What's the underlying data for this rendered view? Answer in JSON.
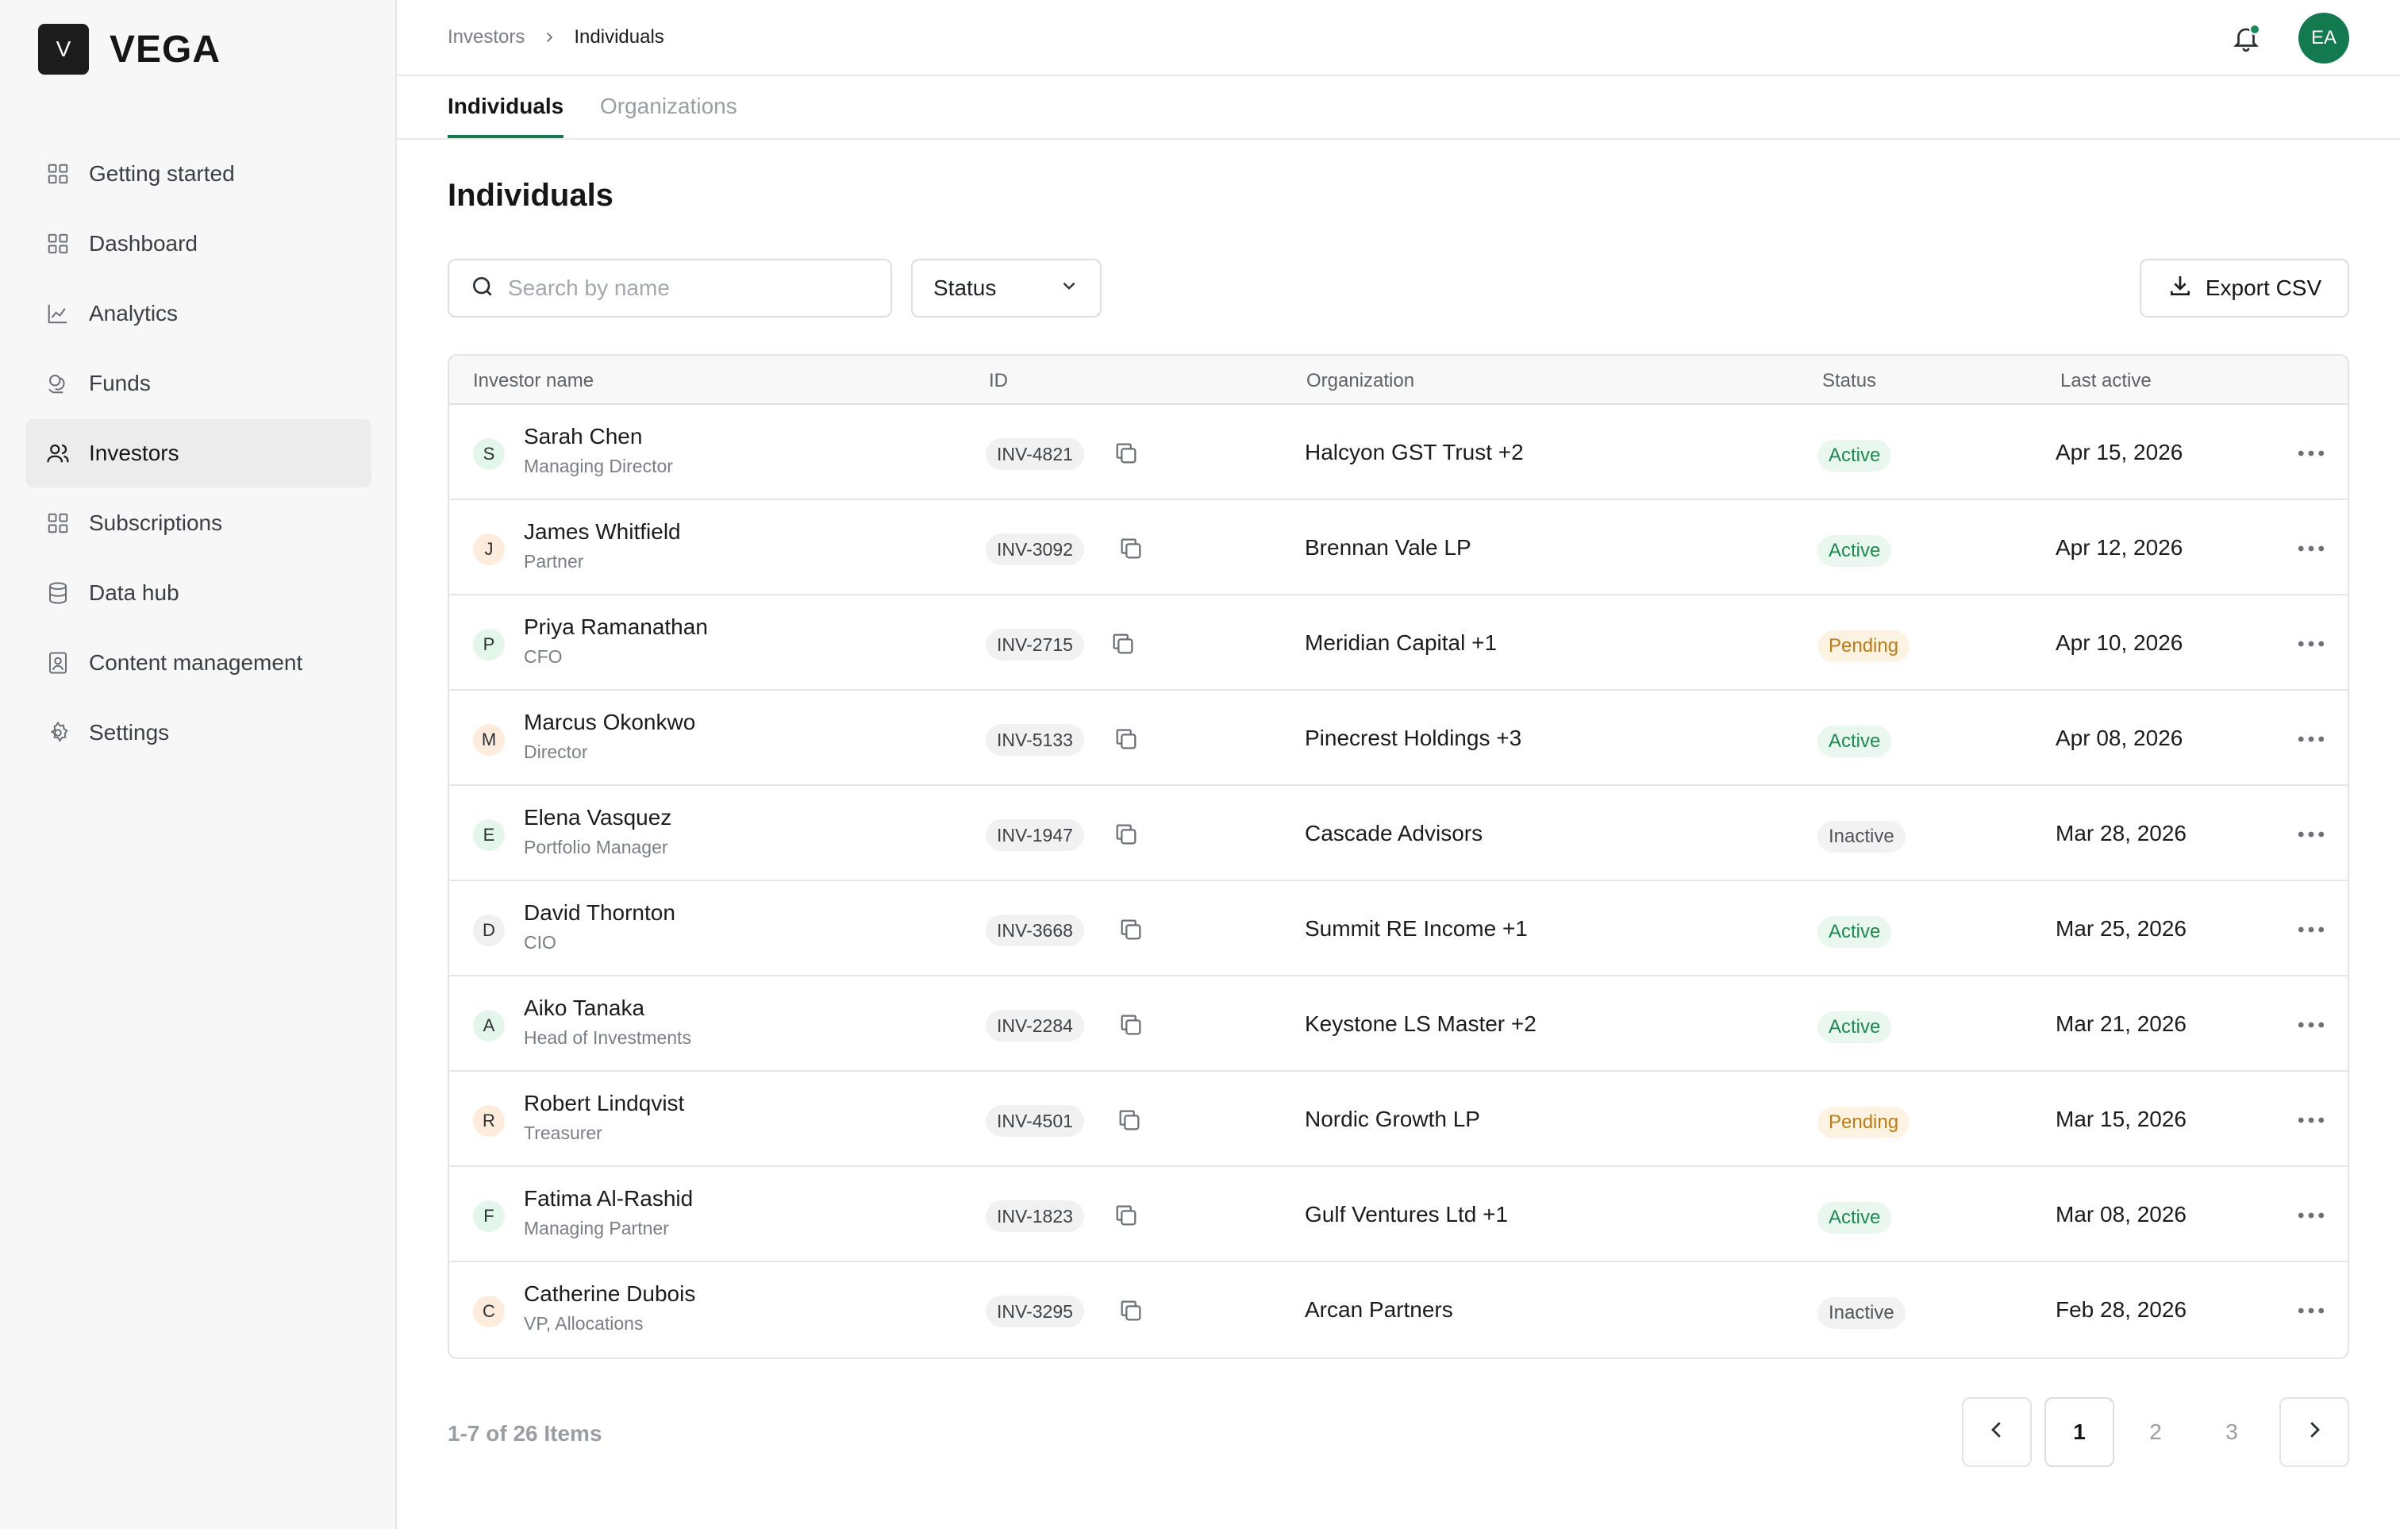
{
  "brand": {
    "mark": "V",
    "name": "VEGA"
  },
  "sidebar": {
    "items": [
      {
        "label": "Getting started",
        "icon": "grid-icon"
      },
      {
        "label": "Dashboard",
        "icon": "grid-icon"
      },
      {
        "label": "Analytics",
        "icon": "chart-line-icon"
      },
      {
        "label": "Funds",
        "icon": "coins-icon"
      },
      {
        "label": "Investors",
        "icon": "users-icon",
        "active": true
      },
      {
        "label": "Subscriptions",
        "icon": "grid-icon"
      },
      {
        "label": "Data hub",
        "icon": "database-icon"
      },
      {
        "label": "Content management",
        "icon": "document-user-icon"
      },
      {
        "label": "Settings",
        "icon": "gear-icon"
      }
    ]
  },
  "header": {
    "breadcrumb": {
      "parent": "Investors",
      "current": "Individuals"
    },
    "avatar_initials": "EA",
    "notification_dot": true
  },
  "tabs": [
    {
      "label": "Individuals",
      "active": true
    },
    {
      "label": "Organizations",
      "active": false
    }
  ],
  "main": {
    "title": "Individuals",
    "search": {
      "placeholder": "Search by name",
      "value": ""
    },
    "status_filter": {
      "label": "Status"
    },
    "export_label": "Export CSV"
  },
  "table": {
    "columns": [
      "Investor name",
      "ID",
      "Organization",
      "Status",
      "Last active"
    ],
    "rows": [
      {
        "initial": "S",
        "name": "Sarah Chen",
        "role": "Managing Director",
        "id": "INV-4821",
        "org": "Halcyon GST Trust +2",
        "status": "Active",
        "last_active": "Apr 15, 2026"
      },
      {
        "initial": "J",
        "name": "James Whitfield",
        "role": "Partner",
        "id": "INV-3092",
        "org": "Brennan Vale LP",
        "status": "Active",
        "last_active": "Apr 12, 2026"
      },
      {
        "initial": "P",
        "name": "Priya Ramanathan",
        "role": "CFO",
        "id": "INV-2715",
        "org": "Meridian Capital +1",
        "status": "Pending",
        "last_active": "Apr 10, 2026"
      },
      {
        "initial": "M",
        "name": "Marcus Okonkwo",
        "role": "Director",
        "id": "INV-5133",
        "org": "Pinecrest Holdings +3",
        "status": "Active",
        "last_active": "Apr 08, 2026"
      },
      {
        "initial": "E",
        "name": "Elena Vasquez",
        "role": "Portfolio Manager",
        "id": "INV-1947",
        "org": "Cascade Advisors",
        "status": "Inactive",
        "last_active": "Mar 28, 2026"
      },
      {
        "initial": "D",
        "name": "David Thornton",
        "role": "CIO",
        "id": "INV-3668",
        "org": "Summit RE Income +1",
        "status": "Active",
        "last_active": "Mar 25, 2026"
      },
      {
        "initial": "A",
        "name": "Aiko Tanaka",
        "role": "Head of Investments",
        "id": "INV-2284",
        "org": "Keystone LS Master +2",
        "status": "Active",
        "last_active": "Mar 21, 2026"
      },
      {
        "initial": "R",
        "name": "Robert Lindqvist",
        "role": "Treasurer",
        "id": "INV-4501",
        "org": "Nordic Growth LP",
        "status": "Pending",
        "last_active": "Mar 15, 2026"
      },
      {
        "initial": "F",
        "name": "Fatima Al-Rashid",
        "role": "Managing Partner",
        "id": "INV-1823",
        "org": "Gulf Ventures Ltd +1",
        "status": "Active",
        "last_active": "Mar 08, 2026"
      },
      {
        "initial": "C",
        "name": "Catherine Dubois",
        "role": "VP, Allocations",
        "id": "INV-3295",
        "org": "Arcan Partners",
        "status": "Inactive",
        "last_active": "Feb 28, 2026"
      }
    ]
  },
  "pagination": {
    "summary": "1-7 of 26 Items",
    "pages": [
      "1",
      "2",
      "3"
    ],
    "current": "1"
  },
  "colors": {
    "accent": "#137a4f",
    "active_badge_bg": "#eaf7ef",
    "active_badge_text": "#1b8a4f",
    "pending_badge_bg": "#fdf3e2",
    "pending_badge_text": "#c17a12",
    "inactive_badge_bg": "#f2f2f2",
    "inactive_badge_text": "#505559",
    "avatar_initial_bg_green": "#e3f6ea",
    "avatar_initial_bg_orange": "#fdebdc",
    "avatar_initial_bg_grey": "#f0f0f0"
  }
}
